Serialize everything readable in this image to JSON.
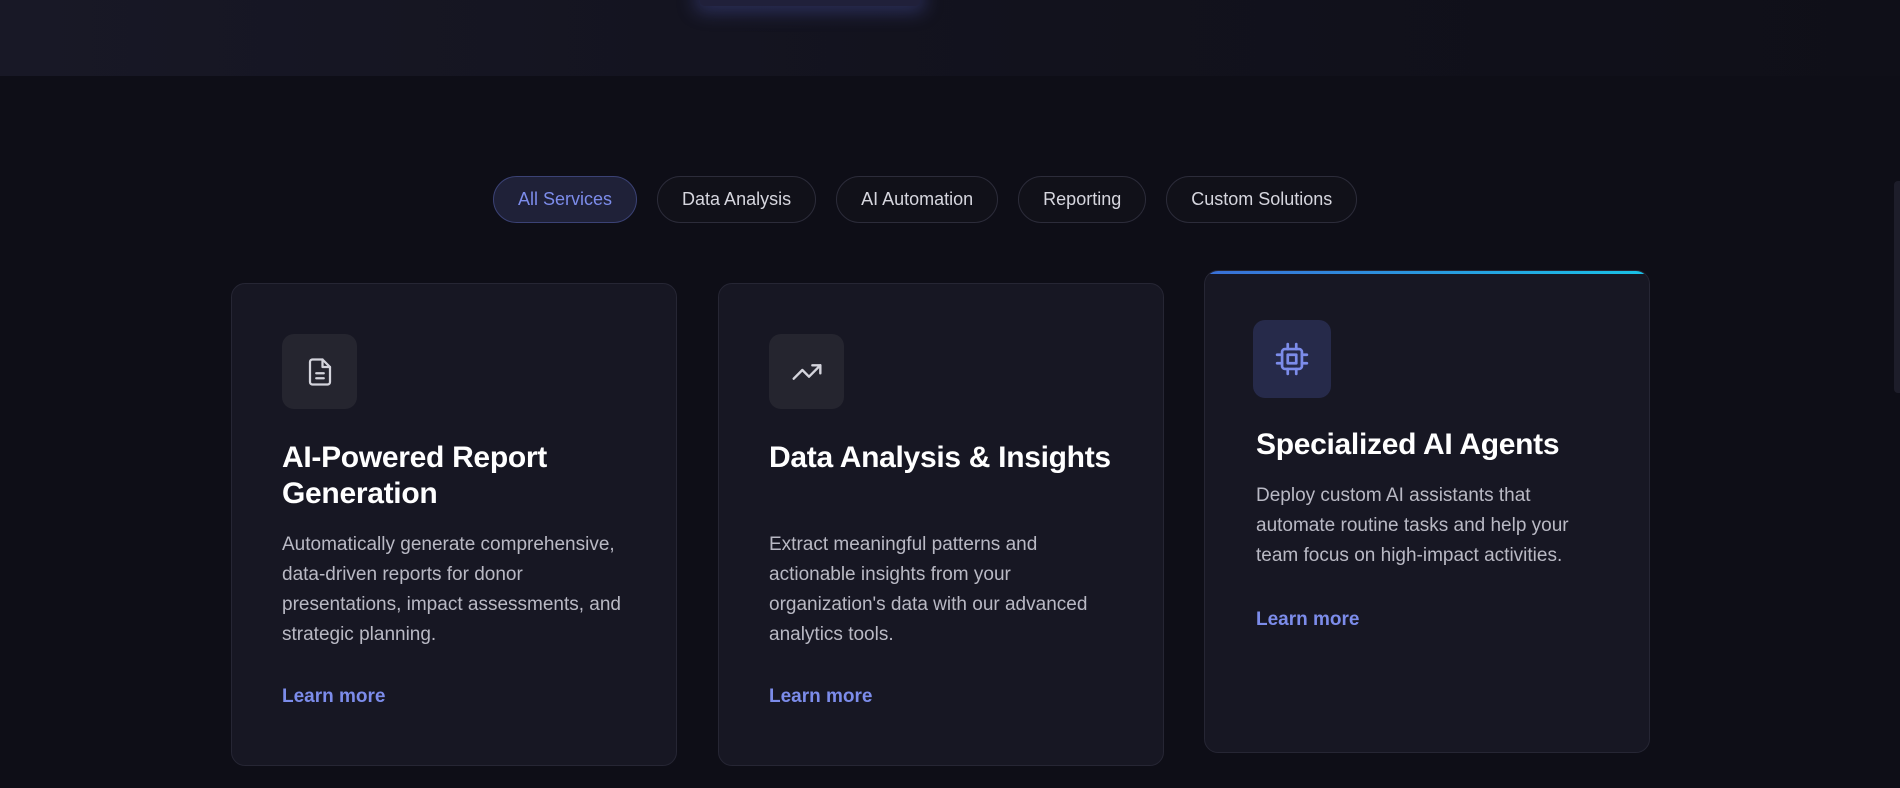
{
  "filters": [
    {
      "label": "All Services",
      "active": true
    },
    {
      "label": "Data Analysis",
      "active": false
    },
    {
      "label": "AI Automation",
      "active": false
    },
    {
      "label": "Reporting",
      "active": false
    },
    {
      "label": "Custom Solutions",
      "active": false
    }
  ],
  "cards": [
    {
      "icon": "document-icon",
      "title": "AI-Powered Report Generation",
      "description": "Automatically generate comprehensive, data-driven reports for donor presentations, impact assessments, and strategic planning.",
      "link": "Learn more"
    },
    {
      "icon": "trending-up-icon",
      "title": "Data Analysis & Insights",
      "description": "Extract meaningful patterns and actionable insights from your organization's data with our advanced analytics tools.",
      "link": "Learn more"
    },
    {
      "icon": "cpu-chip-icon",
      "title": "Specialized AI Agents",
      "description": "Deploy custom AI assistants that automate routine tasks and help your team focus on high-impact activities.",
      "link": "Learn more",
      "highlighted": true
    }
  ],
  "colors": {
    "background": "#0e0e17",
    "card": "#171723",
    "accent": "#7c8cea",
    "highlight_bar": "#19c2e6"
  }
}
